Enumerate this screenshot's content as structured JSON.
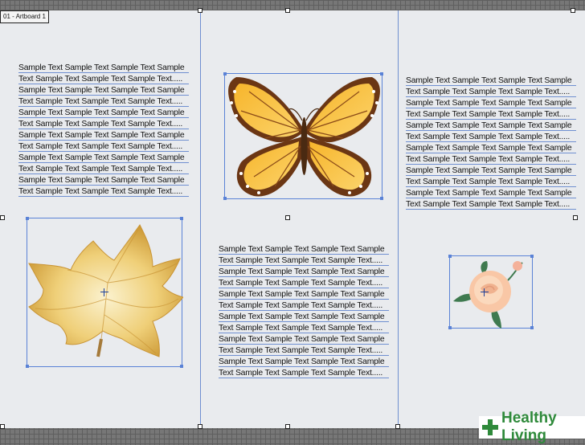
{
  "artboard": {
    "label": "01 - Artboard 1"
  },
  "left_text": [
    "Sample Text Sample Text Sample Text Sample",
    "Text Sample Text Sample Text Sample Text.....",
    "Sample Text Sample Text Sample Text Sample",
    "Text Sample Text Sample Text Sample Text.....",
    "Sample Text Sample Text Sample Text Sample",
    "Text Sample Text Sample Text Sample Text.....",
    "Sample Text Sample Text Sample Text Sample",
    "Text Sample Text Sample Text Sample Text.....",
    "Sample Text Sample Text Sample Text Sample",
    "Text Sample Text Sample Text Sample Text.....",
    "Sample Text Sample Text Sample Text Sample",
    "Text Sample Text Sample Text Sample Text....."
  ],
  "middle_text": [
    "Sample Text Sample Text Sample Text Sample",
    "Text Sample Text Sample Text Sample Text.....",
    "Sample Text Sample Text Sample Text Sample",
    "Text Sample Text Sample Text Sample Text.....",
    "Sample Text Sample Text Sample Text Sample",
    "Text Sample Text Sample Text Sample Text.....",
    "Sample Text Sample Text Sample Text Sample",
    "Text Sample Text Sample Text Sample Text.....",
    "Sample Text Sample Text Sample Text Sample",
    "Text Sample Text Sample Text Sample Text.....",
    "Sample Text Sample Text Sample Text Sample",
    "Text Sample Text Sample Text Sample Text....."
  ],
  "right_text": [
    "Sample Text Sample Text Sample Text Sample",
    "Text Sample Text Sample Text Sample Text.....",
    "Sample Text Sample Text Sample Text Sample",
    "Text Sample Text Sample Text Sample Text.....",
    "Sample Text Sample Text Sample Text Sample",
    "Text Sample Text Sample Text Sample Text.....",
    "Sample Text Sample Text Sample Text Sample",
    "Text Sample Text Sample Text Sample Text.....",
    "Sample Text Sample Text Sample Text Sample",
    "Text Sample Text Sample Text Sample Text.....",
    "Sample Text Sample Text Sample Text Sample",
    "Text Sample Text Sample Text Sample Text....."
  ],
  "images": {
    "leaf": "leaf-illustration",
    "butterfly": "butterfly-illustration",
    "rose": "rose-illustration"
  },
  "watermark": {
    "text": "Healthy Living",
    "brand_color": "#2f8a3b"
  },
  "colors": {
    "guide": "#6f8fd0",
    "selection": "#5a82d6",
    "artboard": "#e9ebee"
  }
}
